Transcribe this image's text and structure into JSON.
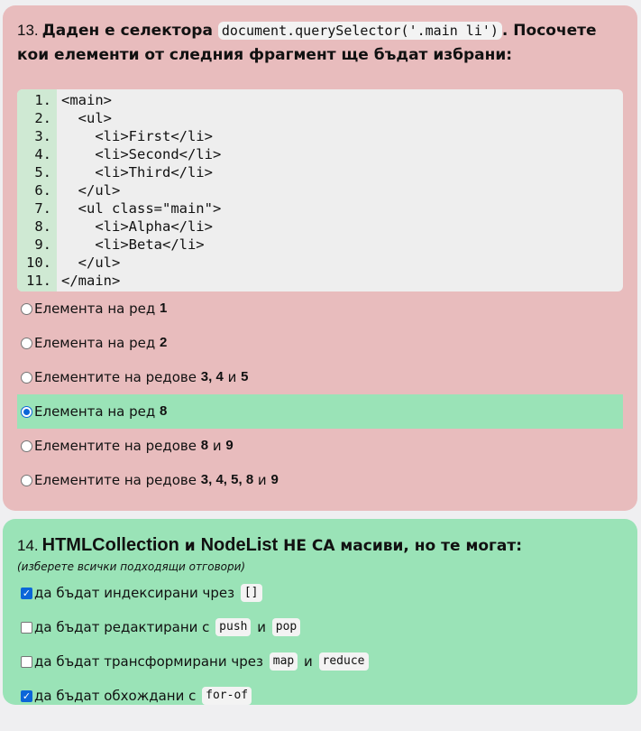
{
  "q13": {
    "number": "13.",
    "title_a": "Даден е селектора",
    "selector": "document.querySelector('.main li')",
    "title_b": ". Посочете кои елементи от следния фрагмент ще бъдат избрани:",
    "code": [
      {
        "n": "1.",
        "t": "<main>"
      },
      {
        "n": "2.",
        "t": "  <ul>"
      },
      {
        "n": "3.",
        "t": "    <li>First</li>"
      },
      {
        "n": "4.",
        "t": "    <li>Second</li>"
      },
      {
        "n": "5.",
        "t": "    <li>Third</li>"
      },
      {
        "n": "6.",
        "t": "  </ul>"
      },
      {
        "n": "7.",
        "t": "  <ul class=\"main\">"
      },
      {
        "n": "8.",
        "t": "    <li>Alpha</li>"
      },
      {
        "n": "9.",
        "t": "    <li>Beta</li>"
      },
      {
        "n": "10.",
        "t": "  </ul>"
      },
      {
        "n": "11.",
        "t": "</main>"
      }
    ],
    "options": [
      {
        "a": "Елемента на ред ",
        "n1": "1",
        "c1": "",
        "n2": "",
        "c2": "",
        "n3": "",
        "selected": false
      },
      {
        "a": "Елемента на ред ",
        "n1": "2",
        "c1": "",
        "n2": "",
        "c2": "",
        "n3": "",
        "selected": false
      },
      {
        "a": "Елементите на редове ",
        "n1": "3, 4",
        "c1": " и ",
        "n2": "5",
        "c2": "",
        "n3": "",
        "selected": false
      },
      {
        "a": "Елемента на ред ",
        "n1": "8",
        "c1": "",
        "n2": "",
        "c2": "",
        "n3": "",
        "selected": true
      },
      {
        "a": "Елементите на редове ",
        "n1": "8",
        "c1": " и ",
        "n2": "9",
        "c2": "",
        "n3": "",
        "selected": false
      },
      {
        "a": "Елементите на редове ",
        "n1": "3, 4, 5, 8",
        "c1": " и ",
        "n2": "9",
        "c2": "",
        "n3": "",
        "selected": false
      }
    ]
  },
  "q14": {
    "number": "14.",
    "kw1": "HTMLCollection",
    "mid": " и ",
    "kw2": "NodeList",
    "rest": " НЕ СА масиви, но те могат:",
    "hint": "(изберете всички подходящи отговори)",
    "options": [
      {
        "a": "да бъдат индексирани чрез ",
        "c1": "[]",
        "m": "",
        "c2": "",
        "checked": true
      },
      {
        "a": "да бъдат редактирани с ",
        "c1": "push",
        "m": " и ",
        "c2": "pop",
        "checked": false
      },
      {
        "a": "да бъдат трансформирани чрез ",
        "c1": "map",
        "m": " и ",
        "c2": "reduce",
        "checked": false
      },
      {
        "a": "да бъдат обхождани с ",
        "c1": "for-of",
        "m": "",
        "c2": "",
        "checked": true
      }
    ]
  },
  "colors": {
    "wrong_card": "#e8bcbd",
    "correct_card": "#9ae3b7",
    "accent": "#0b66d8"
  }
}
